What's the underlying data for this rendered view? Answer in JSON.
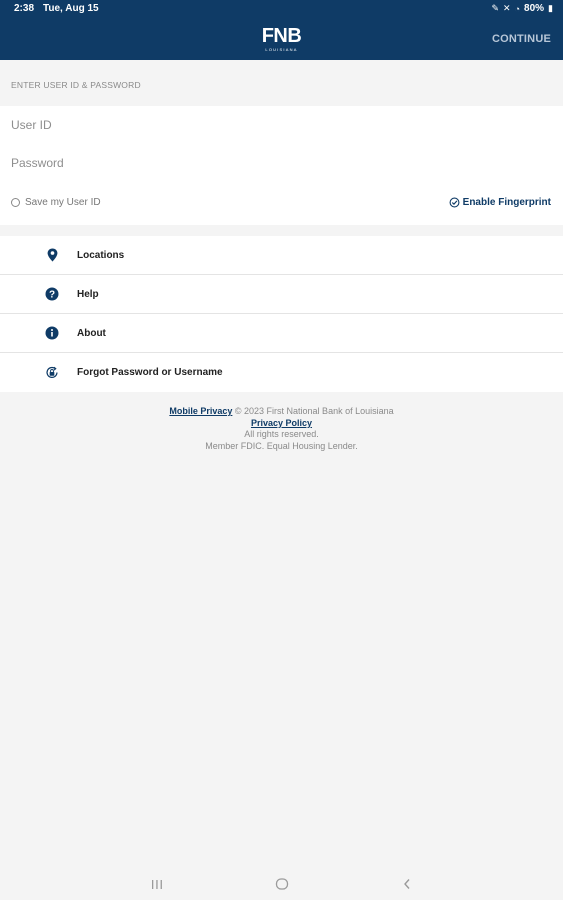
{
  "status_bar": {
    "time": "2:38",
    "date": "Tue, Aug 15",
    "battery": "80%"
  },
  "header": {
    "logo_main": "FNB",
    "logo_sub": "LOUISIANA",
    "continue_label": "CONTINUE"
  },
  "login": {
    "section_label": "ENTER USER ID & PASSWORD",
    "user_placeholder": "User ID",
    "password_placeholder": "Password",
    "save_label": "Save my User ID",
    "fingerprint_label": "Enable Fingerprint"
  },
  "menu": {
    "items": [
      {
        "label": "Locations",
        "icon": "location-pin-icon"
      },
      {
        "label": "Help",
        "icon": "help-icon"
      },
      {
        "label": "About",
        "icon": "info-icon"
      },
      {
        "label": "Forgot Password or Username",
        "icon": "lock-reset-icon"
      }
    ]
  },
  "footer": {
    "mobile_privacy": "Mobile Privacy",
    "copyright": " © 2023 First National Bank of Louisiana",
    "privacy_policy": "Privacy Policy",
    "rights": "All rights reserved.",
    "fdic": "Member FDIC. Equal Housing Lender."
  },
  "colors": {
    "brand": "#0f3b66",
    "background": "#f4f4f4"
  }
}
